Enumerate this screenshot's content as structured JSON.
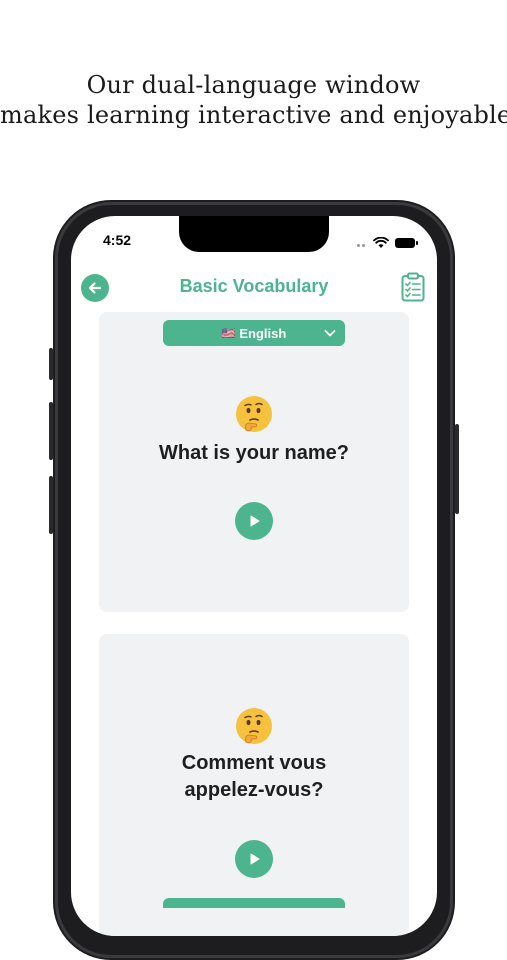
{
  "headline": {
    "line1": "Our dual-language window",
    "line2": "makes learning interactive and enjoyable"
  },
  "status_bar": {
    "time": "4:52"
  },
  "nav": {
    "title": "Basic Vocabulary",
    "back_icon": "arrow-left-icon",
    "right_icon": "clipboard-checklist-icon"
  },
  "cards": [
    {
      "language": {
        "flag": "🇺🇸",
        "label": "English"
      },
      "emoji_icon": "thinking-face-icon",
      "phrase": "What is your name?",
      "play_icon": "play-icon"
    },
    {
      "emoji_icon": "thinking-face-icon",
      "phrase_line1": "Comment vous",
      "phrase_line2": "appelez-vous?",
      "play_icon": "play-icon"
    }
  ],
  "colors": {
    "accent": "#4cb58f",
    "card_bg": "#f1f2f3",
    "text": "#1f1f1f"
  }
}
